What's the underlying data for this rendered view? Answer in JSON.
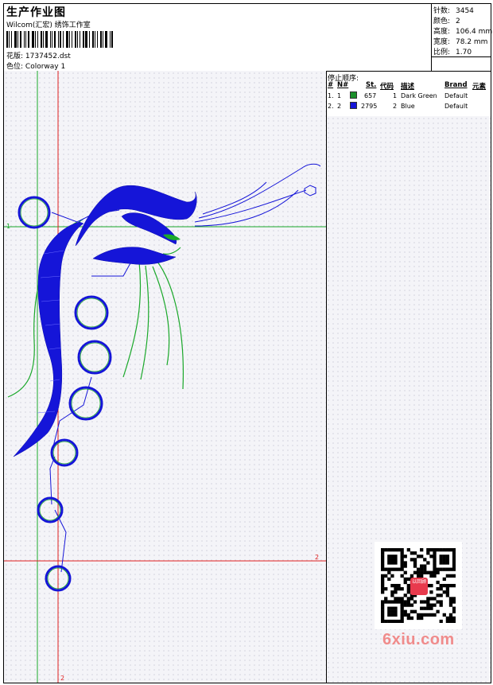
{
  "header": {
    "title": "生产作业图",
    "subtitle": "Wilcom(汇宏) 绣饰工作室",
    "design_label": "花版:",
    "design_value": "1737452.dst",
    "colorway_label": "色位:",
    "colorway_value": "Colorway 1"
  },
  "stats": [
    {
      "label": "针数:",
      "value": "3454"
    },
    {
      "label": "颜色:",
      "value": "2"
    },
    {
      "label": "高度:",
      "value": "106.4 mm"
    },
    {
      "label": "宽度:",
      "value": "78.2 mm"
    },
    {
      "label": "比例:",
      "value": "1.70"
    }
  ],
  "stop_sequence": {
    "title": "停止顺序:",
    "headers": [
      "#",
      "N#",
      "St.",
      "代码",
      "描述",
      "Brand",
      "元素"
    ],
    "rows": [
      {
        "num": "1.",
        "n": "1",
        "color": "#1a8f2a",
        "stitches": "657",
        "code": "1",
        "desc": "Dark Green",
        "brand": "Default"
      },
      {
        "num": "2.",
        "n": "2",
        "color": "#1515d8",
        "stitches": "2795",
        "code": "2",
        "desc": "Blue",
        "brand": "Default"
      }
    ]
  },
  "canvas": {
    "green_marker": "1",
    "red_marker_h": "2",
    "red_marker_v": "2",
    "colors": {
      "green": "#1aa82a",
      "red": "#e02020",
      "blue": "#1515d8"
    }
  },
  "watermark": {
    "text": "6xiu.com",
    "qr_center": "以回顾"
  }
}
